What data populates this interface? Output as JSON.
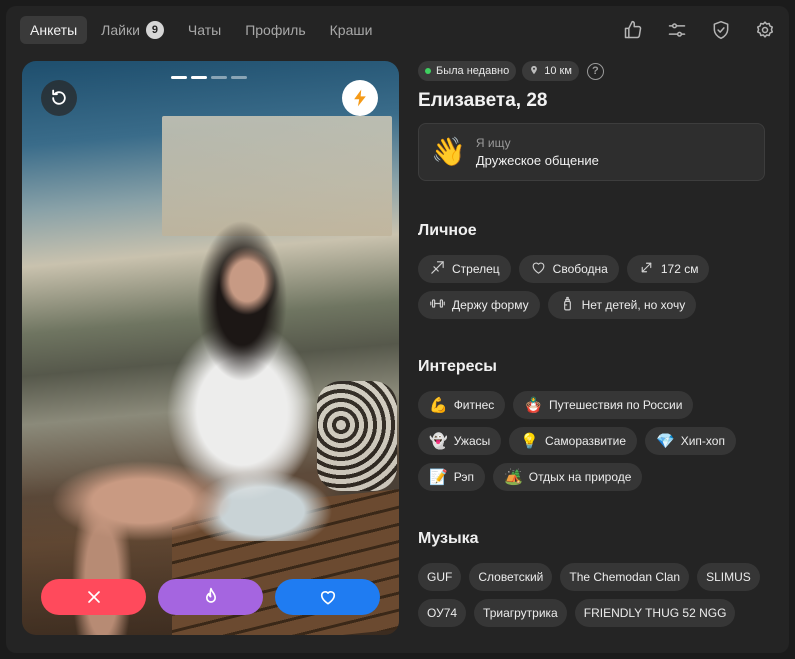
{
  "nav": {
    "tabs": [
      {
        "label": "Анкеты",
        "active": true
      },
      {
        "label": "Лайки",
        "badge": "9"
      },
      {
        "label": "Чаты"
      },
      {
        "label": "Профиль"
      },
      {
        "label": "Краши"
      }
    ],
    "icons": [
      "thumbs-up-icon",
      "sliders-icon",
      "shield-check-icon",
      "gear-icon"
    ]
  },
  "photo": {
    "dots_total": 4,
    "dots_active": 2,
    "actions": [
      "dislike",
      "super-like",
      "like"
    ]
  },
  "profile": {
    "status": "Была недавно",
    "distance": "10 км",
    "name_age": "Елизавета, 28",
    "seeking_label": "Я ищу",
    "seeking_value": "Дружеское общение",
    "seeking_emoji": "👋"
  },
  "personal": {
    "title": "Личное",
    "chips": [
      {
        "icon": "sagittarius-icon",
        "label": "Стрелец"
      },
      {
        "icon": "heart-outline-icon",
        "label": "Свободна"
      },
      {
        "icon": "height-arrows-icon",
        "label": "172 см"
      },
      {
        "icon": "dumbbell-icon",
        "label": "Держу форму"
      },
      {
        "icon": "baby-bottle-icon",
        "label": "Нет детей, но хочу"
      }
    ]
  },
  "interests": {
    "title": "Интересы",
    "chips": [
      {
        "emoji": "💪",
        "label": "Фитнес"
      },
      {
        "emoji": "🪆",
        "label": "Путешествия по России"
      },
      {
        "emoji": "👻",
        "label": "Ужасы"
      },
      {
        "emoji": "💡",
        "label": "Саморазвитие"
      },
      {
        "emoji": "💎",
        "label": "Хип-хоп"
      },
      {
        "emoji": "📝",
        "label": "Рэп"
      },
      {
        "emoji": "🏕️",
        "label": "Отдых на природе"
      }
    ]
  },
  "music": {
    "title": "Музыка",
    "chips": [
      "GUF",
      "Словетский",
      "The Chemodan Clan",
      "SLIMUS",
      "ОУ74",
      "Триагрутрика",
      "FRIENDLY THUG 52 NGG"
    ]
  },
  "colors": {
    "dislike": "#ff4a5c",
    "super_like": "#a565e0",
    "like": "#1f7cf2",
    "boost": "#f59a17",
    "online": "#3fd060"
  }
}
